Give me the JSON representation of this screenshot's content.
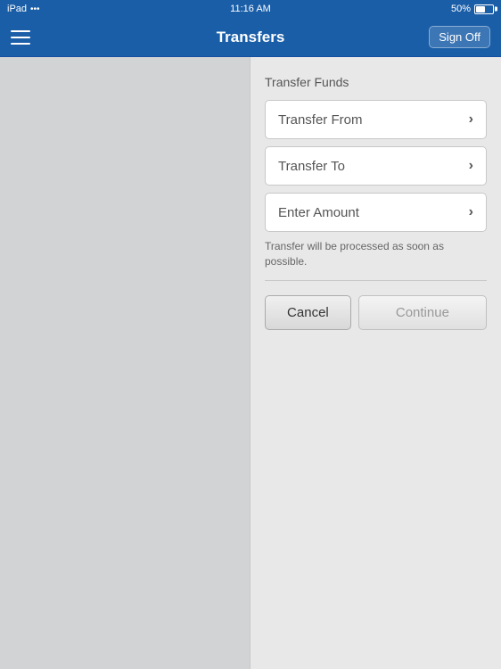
{
  "statusBar": {
    "device": "iPad",
    "wifi": "WiFi",
    "time": "11:16 AM",
    "battery": "50%"
  },
  "navBar": {
    "title": "Transfers",
    "signOff": "Sign Off",
    "menuIcon": "menu"
  },
  "form": {
    "sectionTitle": "Transfer Funds",
    "transferFromLabel": "Transfer From",
    "transferToLabel": "Transfer To",
    "enterAmountLabel": "Enter Amount",
    "noticeText": "Transfer will be processed as soon as possible.",
    "cancelLabel": "Cancel",
    "continueLabel": "Continue"
  }
}
